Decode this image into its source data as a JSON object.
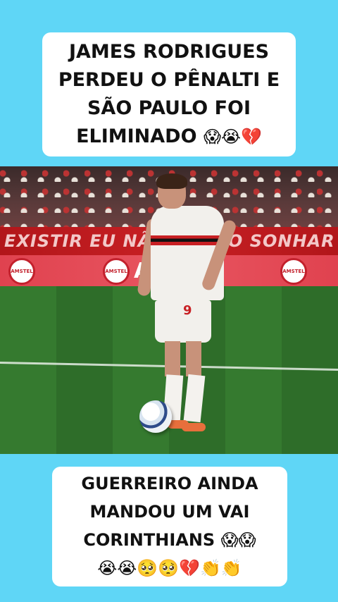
{
  "top_caption": {
    "lines": [
      "JAMES RODRIGUES",
      "PERDEU O PÊNALTI E",
      "SÃO PAULO FOI",
      "ELIMINADO"
    ],
    "emojis": "😱😭💔"
  },
  "scene": {
    "banner_text": "EXISTIR EU NÃO QUERO SONHAR",
    "ad_brand": "AMSTEL",
    "ad_word": "AN",
    "shirt_number": "9"
  },
  "bottom_caption": {
    "lines": [
      "GUERREIRO AINDA",
      "MANDOU UM VAI",
      "CORINTHIANS"
    ],
    "line3_emojis": "😱😱",
    "line4_emojis": "😭😭🥺🥺💔👏👏"
  },
  "colors": {
    "background": "#5fd6f6",
    "caption_bg": "#ffffff",
    "banner_red": "#c82024",
    "ad_red": "#e0424f",
    "pitch_green": "#357a2f"
  }
}
